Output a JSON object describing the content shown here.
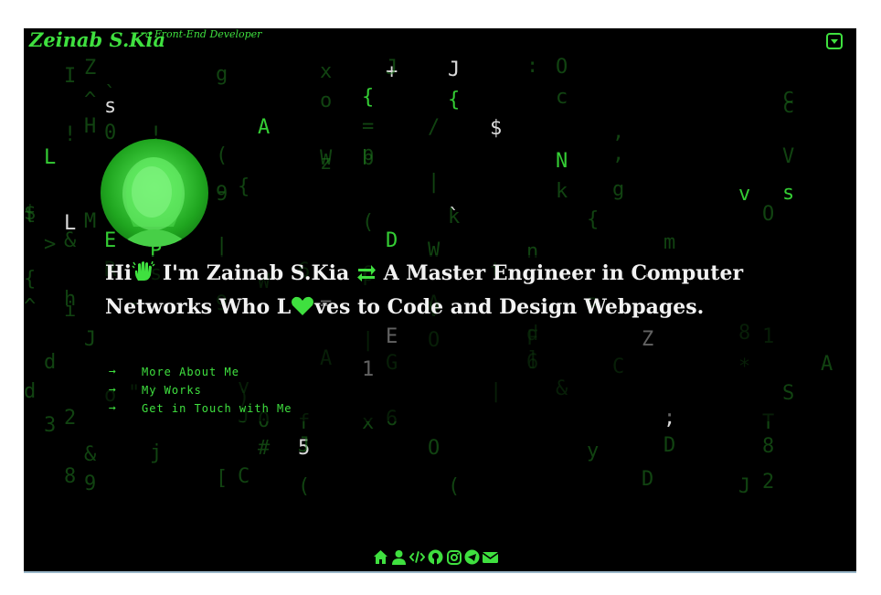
{
  "header": {
    "logo": "Zeinab S.Kia",
    "tagline": "a Front-End Developer",
    "menu_icon": "caret-square-down-icon"
  },
  "intro": {
    "hi": "Hi",
    "wave_icon": "hand-wave-icon",
    "name_part": " I'm Zainab S.Kia ",
    "swap_icon": "exchange-arrows-icon",
    "part2": " A Master Engineer in Computer Networks Who L",
    "heart_icon": "heart-icon",
    "part3": "ves to Code and Design Webpages."
  },
  "links": [
    {
      "arrow": "➞",
      "label": "More About Me"
    },
    {
      "arrow": "➞",
      "label": "My Works"
    },
    {
      "arrow": "➞",
      "label": "Get in Touch with Me"
    }
  ],
  "footer_icons": [
    "home-icon",
    "user-icon",
    "code-icon",
    "github-icon",
    "instagram-icon",
    "telegram-icon",
    "email-icon"
  ],
  "matrix_rain": {
    "colors": {
      "green": "#37d937",
      "dim": "#1f7a1f",
      "white": "#e6e6e6"
    },
    "glyphs": [
      [
        "+",
        "w",
        0
      ],
      [
        "Z",
        "d",
        0
      ],
      [
        "x",
        "d",
        0
      ],
      [
        "I",
        "d",
        0
      ],
      [
        "J",
        "w",
        0
      ],
      [
        "g",
        "d",
        0
      ],
      [
        ":",
        "d",
        0
      ],
      [
        "J",
        "d",
        0
      ],
      [
        "O",
        "d",
        0
      ],
      [
        "{",
        "g",
        0
      ],
      [
        "`",
        "d",
        0
      ],
      [
        "c",
        "d",
        0
      ],
      [
        "^",
        "d",
        0
      ],
      [
        "c",
        "d",
        0
      ],
      [
        "o",
        "d",
        0
      ],
      [
        "c",
        "d",
        0
      ],
      [
        "s",
        "w",
        0
      ],
      [
        "{",
        "g",
        0
      ],
      [
        "/",
        "d",
        0
      ],
      [
        "0",
        "d",
        0
      ],
      [
        "A",
        "g",
        0
      ],
      [
        "!",
        "d",
        0
      ],
      [
        "!",
        "d",
        0
      ],
      [
        "=",
        "d",
        0
      ],
      [
        "$",
        "w",
        0
      ],
      [
        ",",
        "d",
        0
      ],
      [
        "H",
        "d",
        0
      ],
      [
        "p",
        "d",
        0
      ],
      [
        "L",
        "g",
        0
      ],
      [
        "N",
        "g",
        0
      ],
      [
        "V",
        "d",
        0
      ],
      [
        "W",
        "d",
        0
      ],
      [
        "z",
        "d",
        0
      ],
      [
        "b",
        "d",
        0
      ],
      [
        "(",
        "d",
        0
      ],
      [
        ",",
        "d",
        0
      ],
      [
        "-",
        "d",
        0
      ],
      [
        "v",
        "g",
        0
      ],
      [
        "s",
        "g",
        0
      ],
      [
        "g",
        "d",
        0
      ],
      [
        "|",
        "d",
        0
      ],
      [
        "{",
        "d",
        0
      ],
      [
        "e",
        "d",
        0
      ],
      [
        "k",
        "d",
        0
      ],
      [
        "9",
        "d",
        0
      ],
      [
        "t",
        "d",
        0
      ],
      [
        "`",
        "w",
        0
      ],
      [
        "L",
        "w",
        0
      ],
      [
        "(",
        "d",
        0
      ],
      [
        "k",
        "d",
        0
      ],
      [
        "M",
        "d",
        0
      ],
      [
        "O",
        "d",
        0
      ],
      [
        "$",
        "d",
        0
      ],
      [
        "{",
        "d",
        0
      ],
      [
        "n",
        "d",
        0
      ],
      [
        "P",
        "g",
        0
      ],
      [
        "E",
        "g",
        0
      ],
      [
        "&",
        "d",
        0
      ],
      [
        "W",
        "d",
        0
      ],
      [
        "m",
        "d",
        0
      ],
      [
        "D",
        "g",
        0
      ],
      [
        "|",
        "d",
        0
      ],
      [
        ">",
        "d",
        0
      ],
      [
        "s",
        "d",
        0
      ],
      [
        ".",
        "w",
        0
      ],
      [
        "R",
        "d",
        0
      ],
      [
        "t",
        "d",
        0
      ],
      [
        "6",
        "d",
        0
      ],
      [
        "6",
        "d",
        0
      ],
      [
        "{",
        "d",
        0
      ],
      [
        "F",
        "d",
        0
      ],
      [
        "W",
        "d",
        0
      ],
      [
        "P",
        "d",
        0
      ],
      [
        "9",
        "d",
        0
      ],
      [
        "i",
        "d",
        0
      ],
      [
        "h",
        "d",
        0
      ],
      [
        "-",
        "d",
        0
      ],
      [
        "^",
        "d",
        0
      ],
      [
        "=",
        "w",
        0
      ],
      [
        "V",
        "d",
        0
      ],
      [
        "A",
        "d",
        0
      ],
      [
        "J",
        "d",
        0
      ],
      [
        "d",
        "d",
        0
      ],
      [
        "1",
        "d",
        0
      ],
      [
        "|",
        "d",
        0
      ],
      [
        "8",
        "d",
        0
      ],
      [
        "E",
        "w",
        0
      ],
      [
        "Z",
        "w",
        0
      ],
      [
        "O",
        "d",
        0
      ],
      [
        "F",
        "d",
        0
      ],
      [
        "A",
        "d",
        0
      ],
      [
        "A",
        "d",
        0
      ],
      [
        "6",
        "d",
        0
      ],
      [
        "C",
        "d",
        0
      ],
      [
        "G",
        "d",
        0
      ],
      [
        "*",
        "d",
        0
      ],
      [
        "d",
        "d",
        0
      ],
      [
        "1",
        "w",
        0
      ],
      [
        "]",
        "d",
        0
      ],
      [
        "&",
        "d",
        0
      ],
      [
        "\"",
        "d",
        0
      ],
      [
        "v",
        "d",
        0
      ],
      [
        "S",
        "d",
        0
      ],
      [
        "d",
        "d",
        0
      ],
      [
        "o",
        "d",
        0
      ],
      [
        "`",
        "d",
        0
      ],
      [
        ")",
        "d",
        0
      ],
      [
        "|",
        "d",
        0
      ],
      [
        ";",
        "w",
        0
      ],
      [
        "0",
        "d",
        0
      ],
      [
        "T",
        "d",
        0
      ],
      [
        "2",
        "d",
        0
      ],
      [
        "6",
        "d",
        0
      ],
      [
        "f",
        "d",
        0
      ],
      [
        "J",
        "d",
        0
      ],
      [
        "3",
        "d",
        0
      ],
      [
        "x",
        "d",
        0
      ],
      [
        "8",
        "d",
        0
      ],
      [
        "5",
        "w",
        0
      ],
      [
        "J",
        "d",
        0
      ],
      [
        "&",
        "d",
        0
      ],
      [
        "D",
        "d",
        0
      ],
      [
        "O",
        "d",
        0
      ],
      [
        "#",
        "d",
        0
      ],
      [
        "y",
        "d",
        0
      ],
      [
        "j",
        "d",
        0
      ],
      [
        "J",
        "d",
        0
      ],
      [
        "(",
        "d",
        0
      ],
      [
        "D",
        "d",
        0
      ],
      [
        "8",
        "d",
        0
      ],
      [
        "9",
        "d",
        0
      ],
      [
        "(",
        "d",
        0
      ],
      [
        "[",
        "d",
        0
      ],
      [
        "C",
        "d",
        0
      ],
      [
        "2",
        "d",
        0
      ]
    ]
  }
}
